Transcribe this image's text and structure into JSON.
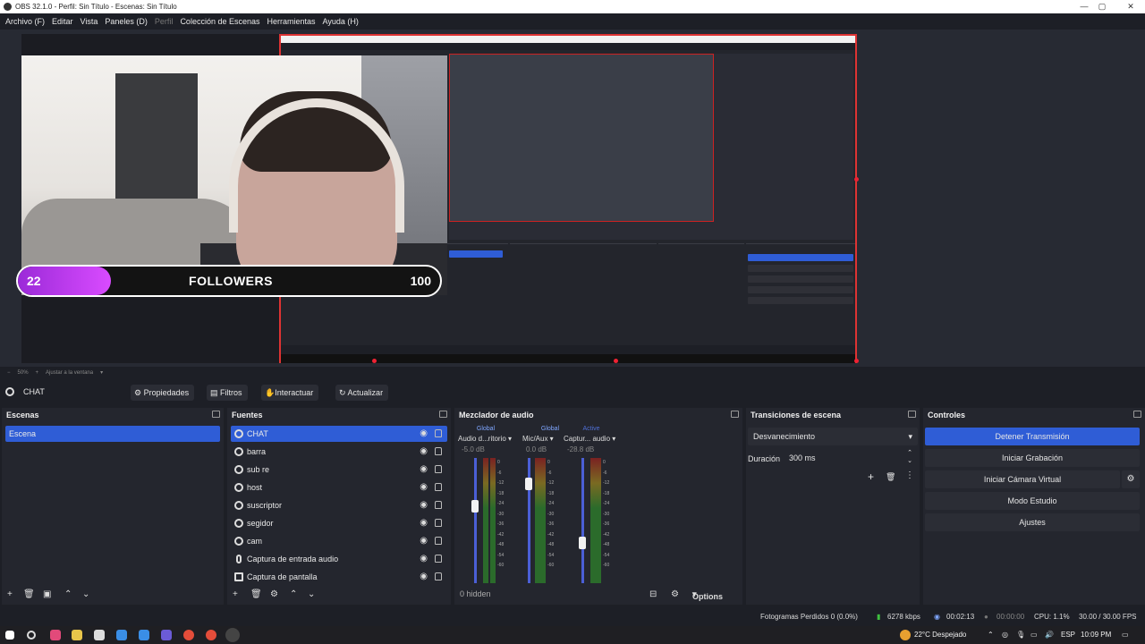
{
  "window": {
    "title": "OBS 32.1.0 - Perfil: Sin Título - Escenas: Sin Título"
  },
  "menu": [
    {
      "label": "Archivo (F)",
      "enabled": true
    },
    {
      "label": "Editar",
      "enabled": true
    },
    {
      "label": "Vista",
      "enabled": true
    },
    {
      "label": "Paneles (D)",
      "enabled": true
    },
    {
      "label": "Perfil",
      "enabled": false
    },
    {
      "label": "Colección de Escenas",
      "enabled": true
    },
    {
      "label": "Herramientas",
      "enabled": true
    },
    {
      "label": "Ayuda (H)",
      "enabled": true
    }
  ],
  "preview": {
    "followers": {
      "current": "22",
      "label": "FOLLOWERS",
      "goal": "100",
      "progress_fraction": 0.22
    }
  },
  "zoombar": {
    "zoom": "50%",
    "fit": "Ajustar a la ventana"
  },
  "context": {
    "source": "CHAT",
    "properties": "Propiedades",
    "filters": "Filtros",
    "interact": "Interactuar",
    "refresh": "Actualizar"
  },
  "scenes": {
    "title": "Escenas",
    "items": [
      "Escena"
    ]
  },
  "sources": {
    "title": "Fuentes",
    "items": [
      "CHAT",
      "barra",
      "sub re",
      "host",
      "suscriptor",
      "segidor",
      "cam",
      "Captura de entrada audio",
      "Captura de pantalla"
    ]
  },
  "mixer": {
    "title": "Mezclador de audio",
    "channels": [
      {
        "tag": "Global",
        "tag_color": "#7fa6ff",
        "device": "Audio d...ritorio",
        "db": "-5.0 dB",
        "level": 0.75
      },
      {
        "tag": "Global",
        "tag_color": "#7fa6ff",
        "device": "Mic/Aux",
        "db": "0.0 dB",
        "level": 0.9
      },
      {
        "tag": "Active",
        "tag_color": "#4f6fd6",
        "device": "Captur... audio",
        "db": "-28.8 dB",
        "level": 0.35
      }
    ],
    "scale": [
      "0",
      "-6",
      "-12",
      "-18",
      "-24",
      "-30",
      "-36",
      "-42",
      "-48",
      "-54",
      "-60"
    ],
    "hidden": "0 hidden",
    "options": "Options"
  },
  "transitions": {
    "title": "Transiciones de escena",
    "selected": "Desvanecimiento",
    "duration_label": "Duración",
    "duration_value": "300 ms"
  },
  "controls": {
    "title": "Controles",
    "buttons": [
      "Detener Transmisión",
      "Iniciar Grabación",
      "Iniciar Cámara Virtual",
      "Modo Estudio",
      "Ajustes"
    ]
  },
  "status": {
    "dropped": "Fotogramas Perdidos 0 (0.0%)",
    "bitrate": "6278 kbps",
    "stream_time": "00:02:13",
    "rec_time": "00:00:00",
    "cpu": "CPU: 1.1%",
    "fps": "30.00 / 30.00 FPS"
  },
  "taskbar": {
    "weather": "22°C  Despejado",
    "lang": "ESP",
    "time": "10:09 PM"
  }
}
